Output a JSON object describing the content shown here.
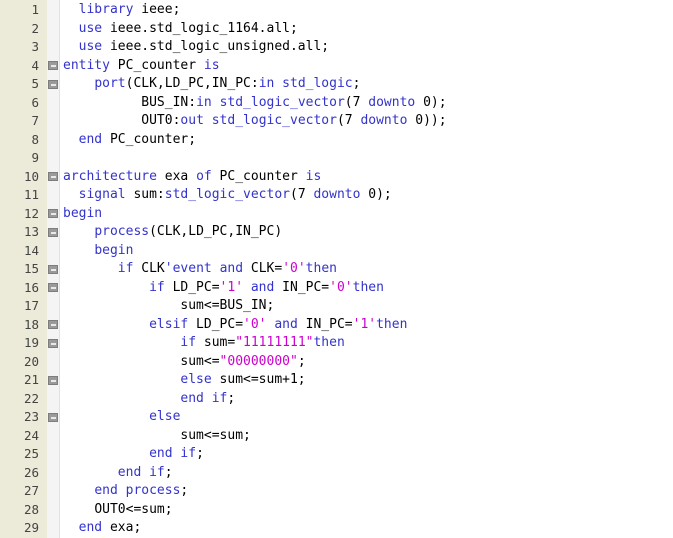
{
  "editor": {
    "language": "VHDL",
    "gutter_bg": "#ECEAD9",
    "fold_col_bg": "#F4F4F4",
    "code_bg": "#FFFFFF",
    "keyword_color": "#3333CC",
    "identifier_color": "#000000",
    "literal_color": "#CC00CC",
    "line_number_color": "#444444",
    "fold_marker_color": "#9A9A9A",
    "fold_marker_glyph": "minus",
    "line_count": 29,
    "lines": [
      {
        "number": "1",
        "fold": false,
        "tokens": [
          {
            "t": "  ",
            "k": "pl"
          },
          {
            "t": "library",
            "k": "kw"
          },
          {
            "t": " ",
            "k": "pl"
          },
          {
            "t": "ieee",
            "k": "id"
          },
          {
            "t": ";",
            "k": "pl"
          }
        ]
      },
      {
        "number": "2",
        "fold": false,
        "tokens": [
          {
            "t": "  ",
            "k": "pl"
          },
          {
            "t": "use",
            "k": "kw"
          },
          {
            "t": " ",
            "k": "pl"
          },
          {
            "t": "ieee.std_logic_1164.all",
            "k": "id"
          },
          {
            "t": ";",
            "k": "pl"
          }
        ]
      },
      {
        "number": "3",
        "fold": false,
        "tokens": [
          {
            "t": "  ",
            "k": "pl"
          },
          {
            "t": "use",
            "k": "kw"
          },
          {
            "t": " ",
            "k": "pl"
          },
          {
            "t": "ieee.std_logic_unsigned.all",
            "k": "id"
          },
          {
            "t": ";",
            "k": "pl"
          }
        ]
      },
      {
        "number": "4",
        "fold": true,
        "tokens": [
          {
            "t": "entity",
            "k": "kw"
          },
          {
            "t": " PC_counter ",
            "k": "id"
          },
          {
            "t": "is",
            "k": "kw"
          }
        ]
      },
      {
        "number": "5",
        "fold": true,
        "tokens": [
          {
            "t": "    ",
            "k": "pl"
          },
          {
            "t": "port",
            "k": "kw"
          },
          {
            "t": "(CLK,LD_PC,IN_PC:",
            "k": "id"
          },
          {
            "t": "in",
            "k": "kw"
          },
          {
            "t": " ",
            "k": "pl"
          },
          {
            "t": "std_logic",
            "k": "kw"
          },
          {
            "t": ";",
            "k": "pl"
          }
        ]
      },
      {
        "number": "6",
        "fold": false,
        "tokens": [
          {
            "t": "          ",
            "k": "pl"
          },
          {
            "t": "BUS_IN:",
            "k": "id"
          },
          {
            "t": "in",
            "k": "kw"
          },
          {
            "t": " ",
            "k": "pl"
          },
          {
            "t": "std_logic_vector",
            "k": "kw"
          },
          {
            "t": "(7 ",
            "k": "id"
          },
          {
            "t": "downto",
            "k": "kw"
          },
          {
            "t": " 0);",
            "k": "id"
          }
        ]
      },
      {
        "number": "7",
        "fold": false,
        "tokens": [
          {
            "t": "          ",
            "k": "pl"
          },
          {
            "t": "OUT0:",
            "k": "id"
          },
          {
            "t": "out",
            "k": "kw"
          },
          {
            "t": " ",
            "k": "pl"
          },
          {
            "t": "std_logic_vector",
            "k": "kw"
          },
          {
            "t": "(7 ",
            "k": "id"
          },
          {
            "t": "downto",
            "k": "kw"
          },
          {
            "t": " 0));",
            "k": "id"
          }
        ]
      },
      {
        "number": "8",
        "fold": false,
        "tokens": [
          {
            "t": "  ",
            "k": "pl"
          },
          {
            "t": "end",
            "k": "kw"
          },
          {
            "t": " PC_counter;",
            "k": "id"
          }
        ]
      },
      {
        "number": "9",
        "fold": false,
        "tokens": []
      },
      {
        "number": "10",
        "fold": true,
        "tokens": [
          {
            "t": "architecture",
            "k": "kw"
          },
          {
            "t": " exa ",
            "k": "id"
          },
          {
            "t": "of",
            "k": "kw"
          },
          {
            "t": " PC_counter ",
            "k": "id"
          },
          {
            "t": "is",
            "k": "kw"
          }
        ]
      },
      {
        "number": "11",
        "fold": false,
        "tokens": [
          {
            "t": "  ",
            "k": "pl"
          },
          {
            "t": "signal",
            "k": "kw"
          },
          {
            "t": " sum:",
            "k": "id"
          },
          {
            "t": "std_logic_vector",
            "k": "kw"
          },
          {
            "t": "(7 ",
            "k": "id"
          },
          {
            "t": "downto",
            "k": "kw"
          },
          {
            "t": " 0);",
            "k": "id"
          }
        ]
      },
      {
        "number": "12",
        "fold": true,
        "tokens": [
          {
            "t": "begin",
            "k": "kw"
          }
        ]
      },
      {
        "number": "13",
        "fold": true,
        "tokens": [
          {
            "t": "    ",
            "k": "pl"
          },
          {
            "t": "process",
            "k": "kw"
          },
          {
            "t": "(CLK,LD_PC,IN_PC)",
            "k": "id"
          }
        ]
      },
      {
        "number": "14",
        "fold": false,
        "tokens": [
          {
            "t": "    ",
            "k": "pl"
          },
          {
            "t": "begin",
            "k": "kw"
          }
        ]
      },
      {
        "number": "15",
        "fold": true,
        "tokens": [
          {
            "t": "       ",
            "k": "pl"
          },
          {
            "t": "if",
            "k": "kw"
          },
          {
            "t": " CLK",
            "k": "id"
          },
          {
            "t": "'event",
            "k": "kw"
          },
          {
            "t": " ",
            "k": "pl"
          },
          {
            "t": "and",
            "k": "kw"
          },
          {
            "t": " CLK=",
            "k": "id"
          },
          {
            "t": "'0'",
            "k": "lit"
          },
          {
            "t": "then",
            "k": "kw"
          }
        ]
      },
      {
        "number": "16",
        "fold": true,
        "tokens": [
          {
            "t": "           ",
            "k": "pl"
          },
          {
            "t": "if",
            "k": "kw"
          },
          {
            "t": " LD_PC=",
            "k": "id"
          },
          {
            "t": "'1'",
            "k": "lit"
          },
          {
            "t": " ",
            "k": "pl"
          },
          {
            "t": "and",
            "k": "kw"
          },
          {
            "t": " IN_PC=",
            "k": "id"
          },
          {
            "t": "'0'",
            "k": "lit"
          },
          {
            "t": "then",
            "k": "kw"
          }
        ]
      },
      {
        "number": "17",
        "fold": false,
        "tokens": [
          {
            "t": "               ",
            "k": "pl"
          },
          {
            "t": "sum<=BUS_IN;",
            "k": "id"
          }
        ]
      },
      {
        "number": "18",
        "fold": true,
        "tokens": [
          {
            "t": "           ",
            "k": "pl"
          },
          {
            "t": "elsif",
            "k": "kw"
          },
          {
            "t": " LD_PC=",
            "k": "id"
          },
          {
            "t": "'0'",
            "k": "lit"
          },
          {
            "t": " ",
            "k": "pl"
          },
          {
            "t": "and",
            "k": "kw"
          },
          {
            "t": " IN_PC=",
            "k": "id"
          },
          {
            "t": "'1'",
            "k": "lit"
          },
          {
            "t": "then",
            "k": "kw"
          }
        ]
      },
      {
        "number": "19",
        "fold": true,
        "tokens": [
          {
            "t": "               ",
            "k": "pl"
          },
          {
            "t": "if",
            "k": "kw"
          },
          {
            "t": " sum=",
            "k": "id"
          },
          {
            "t": "\"11111111\"",
            "k": "lit"
          },
          {
            "t": "then",
            "k": "kw"
          }
        ]
      },
      {
        "number": "20",
        "fold": false,
        "tokens": [
          {
            "t": "               ",
            "k": "pl"
          },
          {
            "t": "sum<=",
            "k": "id"
          },
          {
            "t": "\"00000000\"",
            "k": "lit"
          },
          {
            "t": ";",
            "k": "pl"
          }
        ]
      },
      {
        "number": "21",
        "fold": true,
        "tokens": [
          {
            "t": "               ",
            "k": "pl"
          },
          {
            "t": "else",
            "k": "kw"
          },
          {
            "t": " sum<=sum+1;",
            "k": "id"
          }
        ]
      },
      {
        "number": "22",
        "fold": false,
        "tokens": [
          {
            "t": "               ",
            "k": "pl"
          },
          {
            "t": "end if",
            "k": "kw"
          },
          {
            "t": ";",
            "k": "pl"
          }
        ]
      },
      {
        "number": "23",
        "fold": true,
        "tokens": [
          {
            "t": "           ",
            "k": "pl"
          },
          {
            "t": "else",
            "k": "kw"
          }
        ]
      },
      {
        "number": "24",
        "fold": false,
        "tokens": [
          {
            "t": "               ",
            "k": "pl"
          },
          {
            "t": "sum<=sum;",
            "k": "id"
          }
        ]
      },
      {
        "number": "25",
        "fold": false,
        "tokens": [
          {
            "t": "           ",
            "k": "pl"
          },
          {
            "t": "end if",
            "k": "kw"
          },
          {
            "t": ";",
            "k": "pl"
          }
        ]
      },
      {
        "number": "26",
        "fold": false,
        "tokens": [
          {
            "t": "       ",
            "k": "pl"
          },
          {
            "t": "end if",
            "k": "kw"
          },
          {
            "t": ";",
            "k": "pl"
          }
        ]
      },
      {
        "number": "27",
        "fold": false,
        "tokens": [
          {
            "t": "    ",
            "k": "pl"
          },
          {
            "t": "end process",
            "k": "kw"
          },
          {
            "t": ";",
            "k": "pl"
          }
        ]
      },
      {
        "number": "28",
        "fold": false,
        "tokens": [
          {
            "t": "    ",
            "k": "pl"
          },
          {
            "t": "OUT0<=sum;",
            "k": "id"
          }
        ]
      },
      {
        "number": "29",
        "fold": false,
        "tokens": [
          {
            "t": "  ",
            "k": "pl"
          },
          {
            "t": "end",
            "k": "kw"
          },
          {
            "t": " exa;",
            "k": "id"
          }
        ]
      }
    ]
  }
}
